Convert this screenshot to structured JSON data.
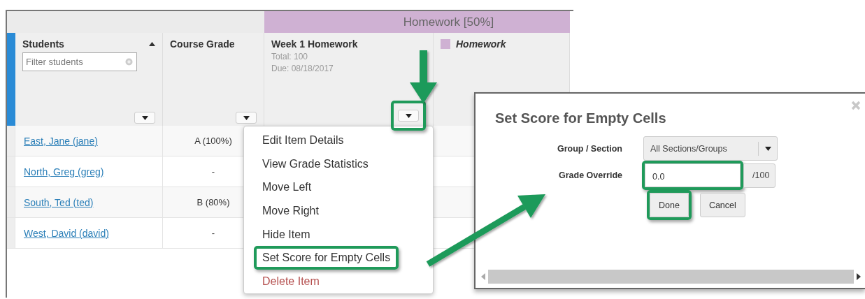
{
  "category_header": {
    "label": "Homework [50%]"
  },
  "students_column": {
    "title": "Students",
    "sort_ascending": true,
    "filter_placeholder": "Filter students"
  },
  "course_grade_column": {
    "title": "Course Grade"
  },
  "item_column": {
    "title": "Week 1 Homework",
    "total": "Total: 100",
    "due": "Due: 08/18/2017",
    "menu_button_annotated": true
  },
  "category_column": {
    "title": "Homework"
  },
  "rows": [
    {
      "student": "East, Jane (jane)",
      "course_grade": "A (100%)"
    },
    {
      "student": "North, Greg (greg)",
      "course_grade": "-"
    },
    {
      "student": "South, Ted (ted)",
      "course_grade": "B (80%)"
    },
    {
      "student": "West, David (david)",
      "course_grade": "-"
    }
  ],
  "item_menu": {
    "items": [
      {
        "label": "Edit Item Details",
        "kind": "action",
        "annotated": false
      },
      {
        "label": "View Grade Statistics",
        "kind": "action",
        "annotated": false
      },
      {
        "label": "Move Left",
        "kind": "action",
        "annotated": false
      },
      {
        "label": "Move Right",
        "kind": "action",
        "annotated": false
      },
      {
        "label": "Hide Item",
        "kind": "action",
        "annotated": false
      },
      {
        "label": "Set Score for Empty Cells",
        "kind": "action",
        "annotated": true
      },
      {
        "label": "Delete Item",
        "kind": "delete",
        "annotated": false
      }
    ]
  },
  "dialog": {
    "title": "Set Score for Empty Cells",
    "group_section": {
      "label": "Group / Section",
      "value": "All Sections/Groups"
    },
    "grade_override": {
      "label": "Grade Override",
      "value": "0.0",
      "suffix": "/100",
      "annotated": true
    },
    "buttons": [
      {
        "label": "Done",
        "annotated": true
      },
      {
        "label": "Cancel",
        "annotated": false
      }
    ]
  }
}
